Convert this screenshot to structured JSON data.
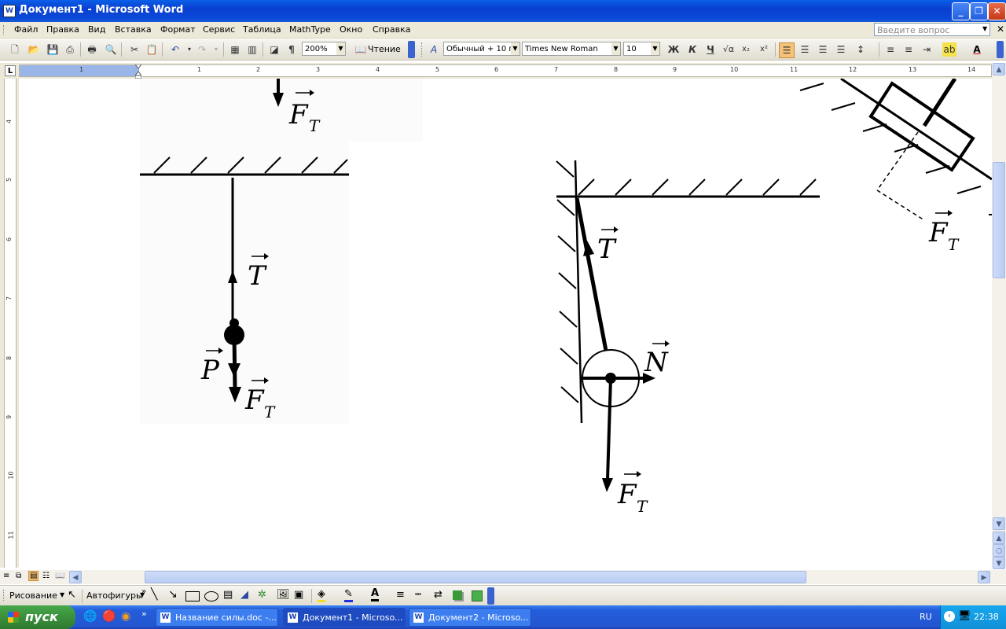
{
  "window": {
    "title": "Документ1 - Microsoft Word",
    "app_icon_letter": "W"
  },
  "menu": {
    "items": [
      "Файл",
      "Правка",
      "Вид",
      "Вставка",
      "Формат",
      "Сервис",
      "Таблица",
      "MathType",
      "Окно",
      "Справка"
    ],
    "ask_placeholder": "Введите вопрос"
  },
  "toolbar": {
    "zoom": "200%",
    "reading_label": "Чтение",
    "style": "Обычный + 10 г",
    "font": "Times New Roman",
    "font_size": "10",
    "bold": "Ж",
    "italic": "К",
    "underline": "Ч"
  },
  "ruler": {
    "numbers": [
      "1",
      "1",
      "2",
      "3",
      "4",
      "5",
      "6",
      "7",
      "8",
      "9",
      "10",
      "11",
      "12",
      "13",
      "14"
    ]
  },
  "vruler": {
    "numbers": [
      "4",
      "5",
      "6",
      "7",
      "8",
      "9",
      "10",
      "11"
    ]
  },
  "diagram": {
    "top_label": "F",
    "top_sub": "T",
    "left": {
      "tension": "T",
      "weight": "P",
      "gravity": "F",
      "gravity_sub": "T"
    },
    "middle": {
      "tension": "T",
      "normal": "N",
      "gravity": "F",
      "gravity_sub": "T"
    },
    "right": {
      "gravity": "F",
      "gravity_sub": "T"
    }
  },
  "drawbar": {
    "drawing": "Рисование",
    "autoshapes": "Автофигуры"
  },
  "taskbar": {
    "start": "пуск",
    "tasks": [
      "Название силы.doc -...",
      "Документ1 - Microso...",
      "Документ2 - Microso..."
    ],
    "lang": "RU",
    "clock": "22:38"
  },
  "colors": {
    "title_bar": "#0a4fd8",
    "taskbar": "#245edb",
    "start": "#3a8f3c"
  }
}
